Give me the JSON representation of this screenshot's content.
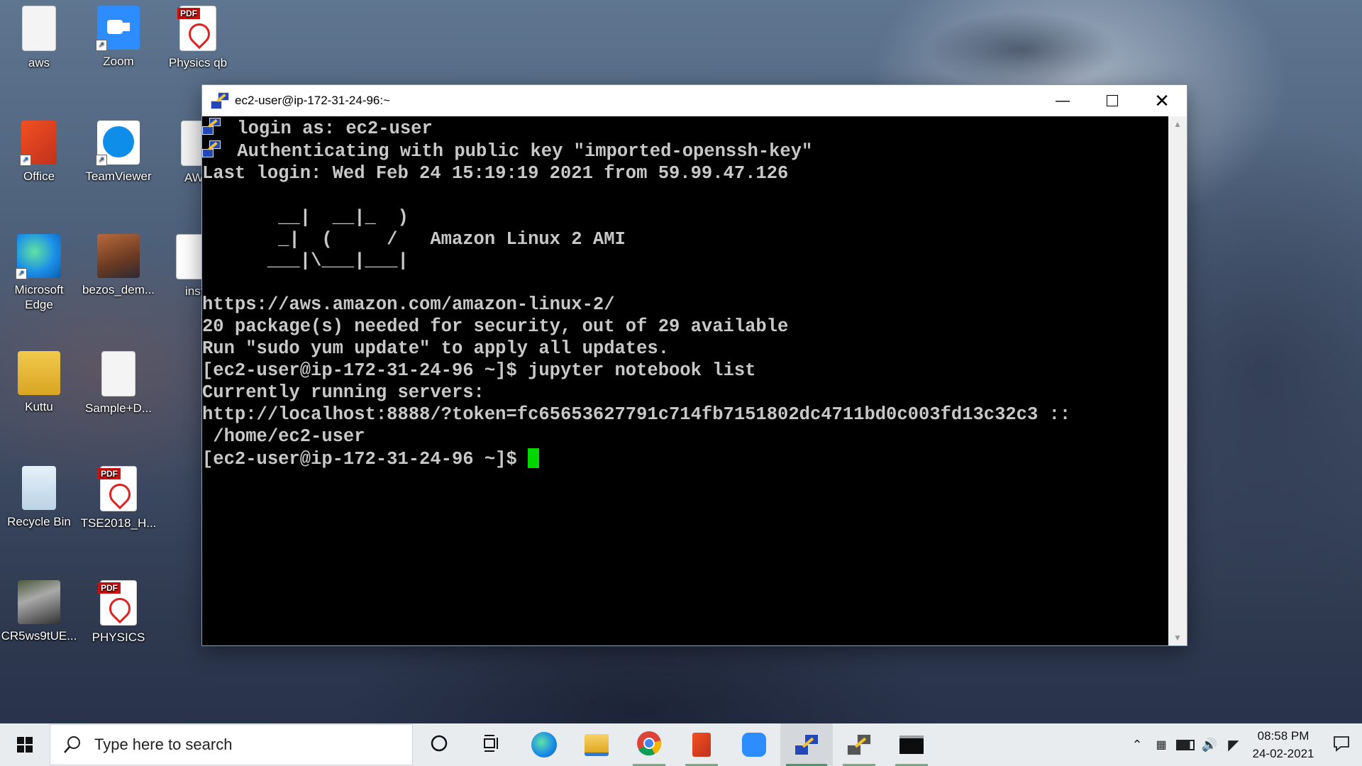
{
  "desktop": {
    "icons": [
      {
        "label": "aws"
      },
      {
        "label": "Zoom"
      },
      {
        "label": "Physics qb"
      },
      {
        "label": "Office"
      },
      {
        "label": "TeamViewer"
      },
      {
        "label": "AWS"
      },
      {
        "label": "Microsoft Edge"
      },
      {
        "label": "bezos_dem..."
      },
      {
        "label": "insta"
      },
      {
        "label": "Kuttu"
      },
      {
        "label": "Sample+D..."
      },
      {
        "label": "Recycle Bin"
      },
      {
        "label": "TSE2018_H..."
      },
      {
        "label": "CR5ws9tUE..."
      },
      {
        "label": "PHYSICS"
      }
    ],
    "pdf_badge": "PDF"
  },
  "terminal": {
    "title": "ec2-user@ip-172-31-24-96:~",
    "lines": [
      " login as: ec2-user",
      " Authenticating with public key \"imported-openssh-key\"",
      "Last login: Wed Feb 24 15:19:19 2021 from 59.99.47.126",
      "",
      "       __|  __|_  )",
      "       _|  (     /   Amazon Linux 2 AMI",
      "      ___|\\___|___|",
      "",
      "https://aws.amazon.com/amazon-linux-2/",
      "20 package(s) needed for security, out of 29 available",
      "Run \"sudo yum update\" to apply all updates.",
      "[ec2-user@ip-172-31-24-96 ~]$ jupyter notebook list",
      "Currently running servers:",
      "http://localhost:8888/?token=fc65653627791c714fb7151802dc4711bd0c003fd13c32c3 ::",
      " /home/ec2-user",
      "[ec2-user@ip-172-31-24-96 ~]$ "
    ],
    "cursor_color": "#00d800"
  },
  "taskbar": {
    "search_placeholder": "Type here to search",
    "apps": [
      "cortana-icon",
      "task-view-icon",
      "edge-icon",
      "file-explorer-icon",
      "chrome-icon",
      "office-icon",
      "zoom-icon",
      "putty-icon",
      "puttygen-icon",
      "cmd-icon"
    ],
    "clock_time": "08:58 PM",
    "clock_date": "24-02-2021"
  }
}
